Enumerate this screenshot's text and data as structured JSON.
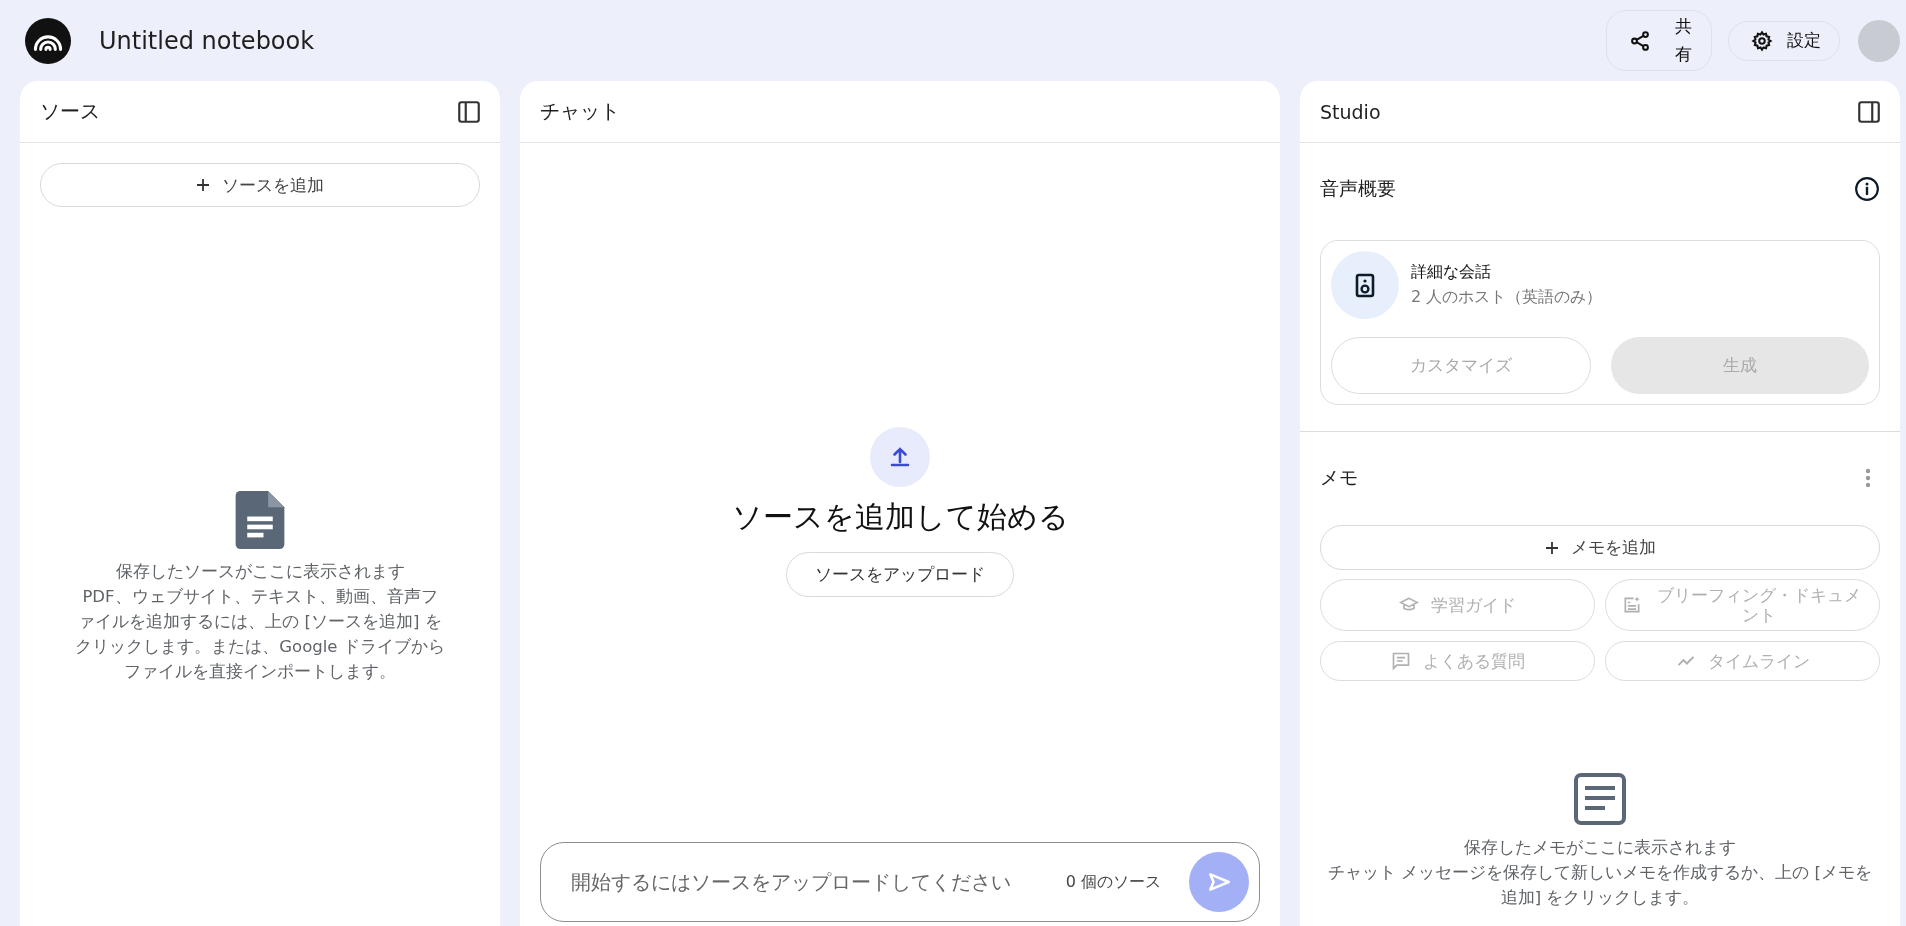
{
  "header": {
    "title": "Untitled notebook",
    "actions": [
      {
        "kind": "share",
        "label": "共有"
      },
      {
        "kind": "settings",
        "label": "設定"
      }
    ]
  },
  "sources": {
    "title": "ソース",
    "add_button": "ソースを追加",
    "empty_title": "保存したソースがここに表示されます",
    "empty_text": "PDF、ウェブサイト、テキスト、動画、音声ファイルを追加するには、上の [ソースを追加] をクリックします。または、Google ドライブからファイルを直接インポートします。"
  },
  "chat": {
    "title": "チャット",
    "empty_title": "ソースを追加して始める",
    "upload_button": "ソースをアップロード",
    "input": {
      "placeholder": "開始するにはソースをアップロードしてください"
    },
    "source_count": "0 個のソース",
    "send_disabled": true
  },
  "studio": {
    "title": "Studio",
    "audio": {
      "heading": "音声概要",
      "title": "詳細な会話",
      "subtitle": "2 人のホスト（英語のみ）",
      "buttons": [
        {
          "kind": "outline",
          "label": "カスタマイズ",
          "disabled": true
        },
        {
          "kind": "filled",
          "label": "生成",
          "disabled": true
        }
      ]
    },
    "notes": {
      "heading": "メモ",
      "add_button": "メモを追加",
      "actions": [
        {
          "kind": "study",
          "label": "学習ガイド",
          "disabled": true
        },
        {
          "kind": "briefing",
          "label": "ブリーフィング・ドキュメント",
          "disabled": true
        },
        {
          "kind": "faq",
          "label": "よくある質問",
          "disabled": true
        },
        {
          "kind": "timeline",
          "label": "タイムライン",
          "disabled": true
        }
      ],
      "empty_title": "保存したメモがここに表示されます",
      "empty_text": "チャット メッセージを保存して新しいメモを作成するか、上の [メモを追加] をクリックします。"
    }
  }
}
